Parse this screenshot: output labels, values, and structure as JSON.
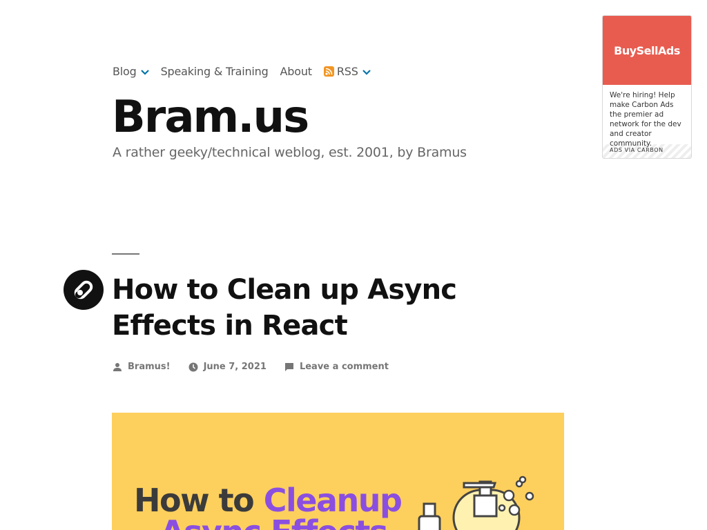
{
  "nav": {
    "items": [
      {
        "label": "Blog",
        "has_dropdown": true
      },
      {
        "label": "Speaking & Training",
        "has_dropdown": false
      },
      {
        "label": "About",
        "has_dropdown": false
      },
      {
        "label": "RSS",
        "has_dropdown": true,
        "icon": "rss-icon"
      }
    ]
  },
  "site": {
    "title": "Bram.us",
    "description": "A rather geeky/technical weblog, est. 2001, by Bramus"
  },
  "ad": {
    "brand": "BuySellAds",
    "text": "We're hiring! Help make Carbon Ads the premier ad network for the dev and creator community.",
    "via": "ADS VIA CARBON"
  },
  "post": {
    "title": "How to Clean up Async Effects in React",
    "author": "Bramus!",
    "date": "June 7, 2021",
    "comments": "Leave a comment",
    "format_icon": "link-icon"
  },
  "feature_image": {
    "line1_dark": "How to ",
    "line1_accent": "Cleanup",
    "line2": "Async Effects"
  },
  "colors": {
    "accent": "#0073aa",
    "ad_red": "#e85c50",
    "feature_bg": "#fdcf5d",
    "feature_purple": "#8a4fe0",
    "rss_orange": "#f29522"
  }
}
